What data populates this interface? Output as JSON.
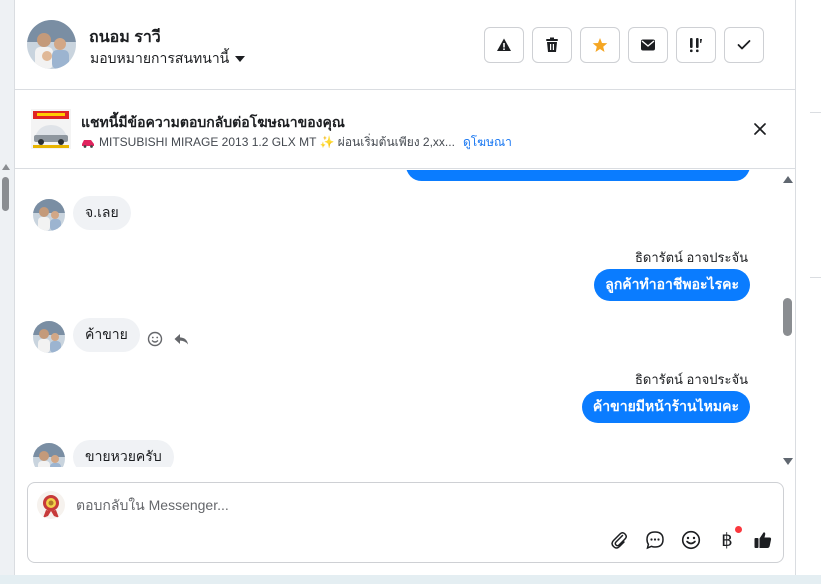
{
  "contact": {
    "name": "ถนอม ราวี",
    "assign_label": "มอบหมายการสนทนานี้"
  },
  "header_actions": [
    {
      "icon": "warning-icon"
    },
    {
      "icon": "trash-icon"
    },
    {
      "icon": "star-icon",
      "color": "#f5a623"
    },
    {
      "icon": "mail-icon"
    },
    {
      "icon": "follow-up-icon"
    },
    {
      "icon": "check-icon"
    }
  ],
  "ad_banner": {
    "title": "แชทนี้มีข้อความตอบกลับต่อโฆษณาของคุณ",
    "text": "MITSUBISHI MIRAGE 2013 1.2 GLX MT ✨ ผ่อนเริ่มต้นเพียง 2,xx...",
    "link": "ดูโฆษณา"
  },
  "messages": [
    {
      "direction": "in",
      "text": "จ.เลย"
    },
    {
      "direction": "out",
      "sender": "ธิดารัตน์ อาจประจัน",
      "text": "ลูกค้าทำอาชีพอะไรคะ"
    },
    {
      "direction": "in",
      "text": "ค้าขาย"
    },
    {
      "direction": "out",
      "sender": "ธิดารัตน์ อาจประจัน",
      "text": "ค้าขายมีหน้าร้านไหมคะ"
    },
    {
      "direction": "in",
      "text": "ขายหวยครับ"
    }
  ],
  "composer": {
    "placeholder": "ตอบกลับใน Messenger..."
  },
  "colors": {
    "accent": "#0a7cff",
    "incoming_bubble": "#f0f2f5"
  }
}
